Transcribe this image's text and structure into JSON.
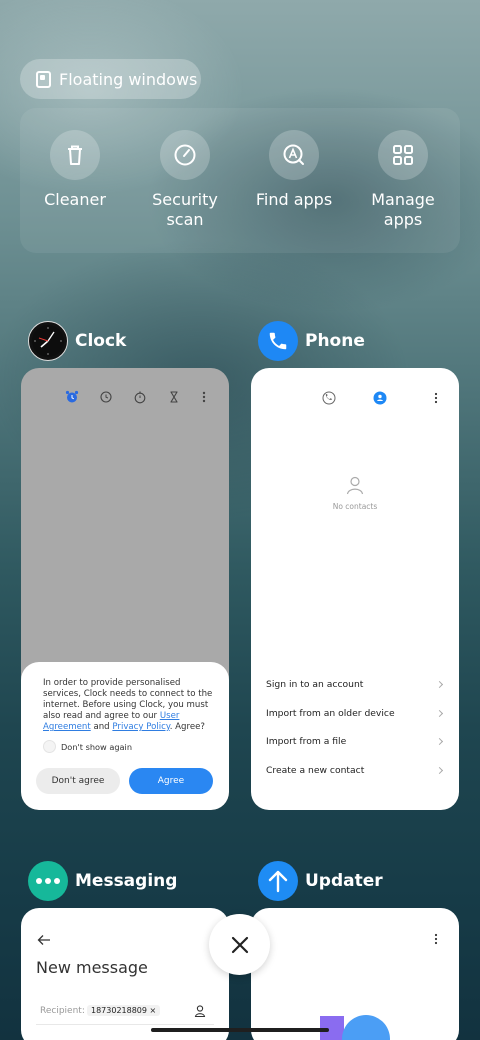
{
  "floating": {
    "label": "Floating windows"
  },
  "tools": [
    {
      "label": "Cleaner",
      "icon": "trash-icon"
    },
    {
      "label": "Security scan",
      "icon": "gauge-icon"
    },
    {
      "label": "Find apps",
      "icon": "find-apps-icon"
    },
    {
      "label": "Manage apps",
      "icon": "grid-icon"
    }
  ],
  "apps": {
    "clock": {
      "name": "Clock",
      "dialog": {
        "text1": "In order to provide personalised services, Clock needs to connect to the internet. Before using Clock, you must also read and agree to our ",
        "link1": "User Agreement",
        "and": " and ",
        "link2": "Privacy Policy",
        "text2": ". Agree?",
        "checkbox": "Don't show again",
        "disagree": "Don't agree",
        "agree": "Agree"
      }
    },
    "phone": {
      "name": "Phone",
      "empty": "No contacts",
      "options": [
        "Sign in to an account",
        "Import from an older device",
        "Import from a file",
        "Create a new contact"
      ]
    },
    "messaging": {
      "name": "Messaging",
      "title": "New message",
      "recipient_label": "Recipient:",
      "recipient_chip": "18730218809 ×"
    },
    "updater": {
      "name": "Updater"
    }
  },
  "colors": {
    "accent_blue": "#2a87f2",
    "phone_blue": "#1e88f5",
    "messaging_green": "#16b89a",
    "updater_blue": "#1e8cf4"
  }
}
